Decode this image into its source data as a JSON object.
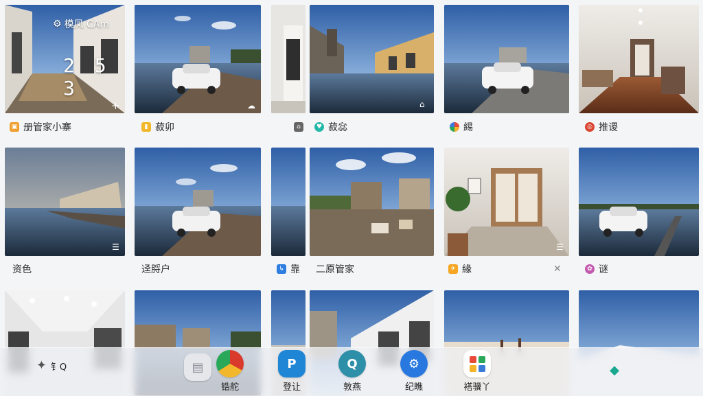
{
  "overlay": {
    "camera_title": "模凤 CAm",
    "clock": "2 5 3"
  },
  "row1_labels": [
    {
      "text": "册管家小寨",
      "icon": "bag-icon",
      "color": "#f0a030"
    },
    {
      "text": "菽卯",
      "icon": "flag-icon",
      "color": "#f2b72a"
    },
    {
      "text": "",
      "icon": "home-icon",
      "color": "#666666"
    },
    {
      "text": "菽惢",
      "icon": "heart-icon",
      "color": "#22b8a8"
    },
    {
      "text": "緆",
      "icon": "pinwheel-icon",
      "color": "#3b7bd8"
    },
    {
      "text": "推谡",
      "icon": "compass-icon",
      "color": "#d9432f"
    }
  ],
  "row2_labels": [
    {
      "text": "资色",
      "icon": "",
      "color": ""
    },
    {
      "text": "迳脟户",
      "icon": "",
      "color": ""
    },
    {
      "text": "靠",
      "icon": "arrow-icon",
      "color": "#2e7de0"
    },
    {
      "text": "二原管家",
      "icon": "",
      "color": ""
    },
    {
      "text": "緣",
      "icon": "plane-icon",
      "color": "#f5a623"
    },
    {
      "text": "谜",
      "icon": "flower-icon",
      "color": "#c45ab0"
    }
  ],
  "dock": [
    {
      "label": "钅Q",
      "icon": "spark-icon",
      "color": "#6f7380"
    },
    {
      "label": "",
      "icon": "chat-icon",
      "color": "#9aa0aa"
    },
    {
      "label": "锆舵",
      "icon": "chrome-like-icon",
      "color": "#d93a2c"
    },
    {
      "label": "登让",
      "icon": "p-brand-icon",
      "color": "#1f86d6"
    },
    {
      "label": "敦燕",
      "icon": "q-brand-icon",
      "color": "#2d8fa8"
    },
    {
      "label": "纪瞧",
      "icon": "gear-icon",
      "color": "#2878e0"
    },
    {
      "label": "褡骥丫",
      "icon": "apps-grid-icon",
      "color": "#ffffff"
    },
    {
      "label": "",
      "icon": "diamond-icon",
      "color": "#1aa890"
    }
  ]
}
